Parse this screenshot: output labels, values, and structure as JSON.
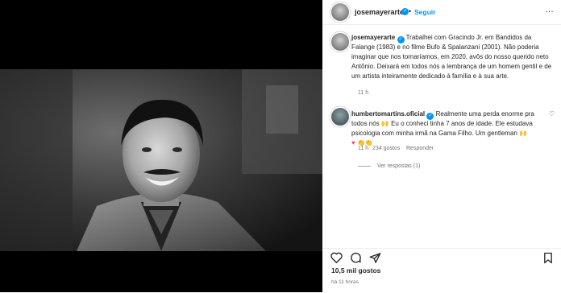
{
  "post": {
    "author": "josemayerarte",
    "follow_label": "Seguir",
    "separator": "•",
    "more_icon": "…",
    "caption_author": "josemayerarte",
    "caption_text": "Trabalhei com Gracindo Jr. em Bandidos da Falange (1983) e no filme Bufo & Spalanzani (2001). Não poderia imaginar que nos tornaríamos, em 2020, avôs do nosso querido neto Antônio. Deixará em todos nós a lembrança de um homem gentil e de um artista inteiramente dedicado à família e à sua arte.",
    "caption_time": "11 h",
    "likes": "10,5 mil gostos",
    "posted_ago": "há 11 horas"
  },
  "comment": {
    "author": "humbertomartins.oficial",
    "text": "Realmente uma perda enorme pra todos nós 🙌 Eu o conheci tinha 7 anos de idade. Ele estudava psicologia com minha irmã na Gama Filho. Um gentleman 🙌",
    "emoji_line": "♥ 👏👏",
    "time": "11 h",
    "likes": "234 gostos",
    "reply_label": "Responder",
    "view_replies": "Ver respostas (1)"
  },
  "icons": {
    "verified": "verified-badge-icon",
    "heart": "heart-icon",
    "comment": "comment-icon",
    "share": "share-icon",
    "save": "bookmark-icon",
    "more": "more-options-icon"
  },
  "colors": {
    "accent": "#0095f6",
    "text": "#262626",
    "muted": "#737373"
  }
}
